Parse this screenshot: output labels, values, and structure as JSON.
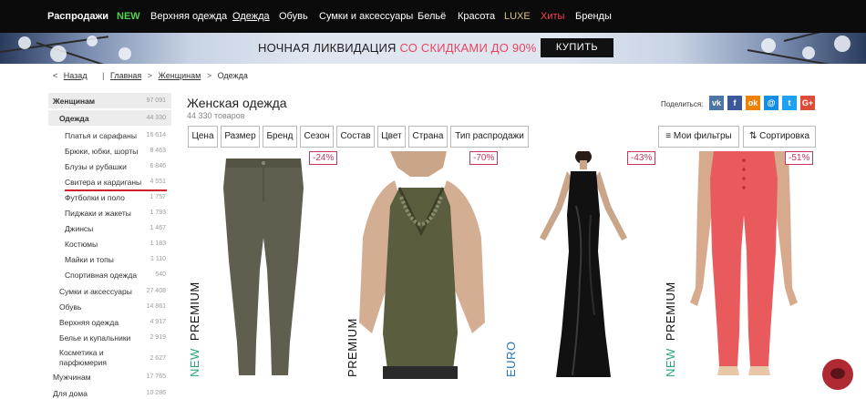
{
  "nav": {
    "items": [
      {
        "label": "Распродажи"
      },
      {
        "label": "NEW"
      },
      {
        "label": "Верхняя одежда"
      },
      {
        "label": "Одежда"
      },
      {
        "label": "Обувь"
      },
      {
        "label": "Сумки и аксессуары"
      },
      {
        "label": "Бельё"
      },
      {
        "label": "Красота"
      },
      {
        "label": "LUXE"
      },
      {
        "label": "Хиты"
      },
      {
        "label": "Бренды"
      }
    ]
  },
  "banner": {
    "text_main": "НОЧНАЯ ЛИКВИДАЦИЯ",
    "text_accent": "СО СКИДКАМИ ДО 90%",
    "button": "КУПИТЬ"
  },
  "breadcrumb": {
    "back": "Назад",
    "items": [
      "Главная",
      "Женщинам",
      "Одежда"
    ]
  },
  "sidebar": {
    "rows": [
      {
        "label": "Женщинам",
        "count": "97 091"
      },
      {
        "label": "Одежда",
        "count": "44 330"
      },
      {
        "label": "Платья и сарафаны",
        "count": "16 614"
      },
      {
        "label": "Брюки, юбки, шорты",
        "count": "8 463"
      },
      {
        "label": "Блузы и рубашки",
        "count": "6 846"
      },
      {
        "label": "Свитера и кардиганы",
        "count": "4 551"
      },
      {
        "label": "Футболки и поло",
        "count": "1 757"
      },
      {
        "label": "Пиджаки и жакеты",
        "count": "1 793"
      },
      {
        "label": "Джинсы",
        "count": "1 467"
      },
      {
        "label": "Костюмы",
        "count": "1 183"
      },
      {
        "label": "Майки и топы",
        "count": "1 110"
      },
      {
        "label": "Спортивная одежда",
        "count": "540"
      },
      {
        "label": "Сумки и аксессуары",
        "count": "27 408"
      },
      {
        "label": "Обувь",
        "count": "14 861"
      },
      {
        "label": "Верхняя одежда",
        "count": "4 917"
      },
      {
        "label": "Белье и купальники",
        "count": "2 919"
      },
      {
        "label": "Косметика и",
        "label2": "парфюмерия",
        "count": "2 627"
      },
      {
        "label": "Мужчинам",
        "count": "17 765"
      },
      {
        "label": "Для дома",
        "count": "10 286"
      }
    ]
  },
  "content": {
    "title": "Женская одежда",
    "count": "44 330 товаров",
    "share_label": "Поделиться:",
    "social": [
      {
        "icon": "vk-icon",
        "glyph": "vk",
        "color": "#4c75a3"
      },
      {
        "icon": "facebook-icon",
        "glyph": "f",
        "color": "#3b5998"
      },
      {
        "icon": "odnoklassniki-icon",
        "glyph": "ok",
        "color": "#ee8208"
      },
      {
        "icon": "moimir-icon",
        "glyph": "@",
        "color": "#168de2"
      },
      {
        "icon": "twitter-icon",
        "glyph": "t",
        "color": "#1da1f2"
      },
      {
        "icon": "googleplus-icon",
        "glyph": "G+",
        "color": "#dd4b39"
      }
    ]
  },
  "filters": [
    "Цена",
    "Размер",
    "Бренд",
    "Сезон",
    "Состав",
    "Цвет",
    "Страна",
    "Тип распродажи"
  ],
  "tools": {
    "my_filters": "Мои фильтры",
    "sort": "Сортировка"
  },
  "products": [
    {
      "discount": "-24%",
      "tags": [
        "NEW",
        "PREMIUM"
      ],
      "garment": "olive-leggings"
    },
    {
      "discount": "-70%",
      "tags": [
        "PREMIUM"
      ],
      "garment": "olive-top"
    },
    {
      "discount": "-43%",
      "tags": [
        "EURO"
      ],
      "garment": "black-gown"
    },
    {
      "discount": "-51%",
      "tags": [
        "NEW",
        "PREMIUM"
      ],
      "garment": "coral-pants"
    }
  ],
  "colors": {
    "nav_bg": "#0b0b0b",
    "new": "#4cd34c",
    "luxe": "#d8c27a",
    "hits": "#ff3b5c",
    "accent": "#e84560",
    "discount": "#c8365c",
    "tag_new": "#2aa876",
    "tag_euro": "#2a76b8",
    "active_underline": "#d0202a"
  }
}
